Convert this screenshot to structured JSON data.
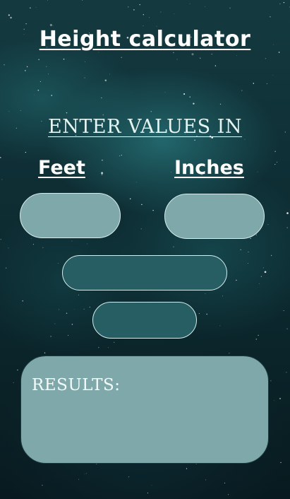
{
  "header": {
    "title": "Height calculator"
  },
  "form": {
    "instruction": "ENTER VALUES IN",
    "feet_label": "Feet",
    "inches_label": "Inches",
    "feet_value": "",
    "inches_value": ""
  },
  "buttons": {
    "primary_label": "",
    "secondary_label": ""
  },
  "results": {
    "label": "RESULTS:",
    "value": ""
  },
  "colors": {
    "input_fill": "#7fa8ab",
    "button_fill": "#265e63",
    "border": "#d6ecec",
    "background": "#0c2a30"
  }
}
